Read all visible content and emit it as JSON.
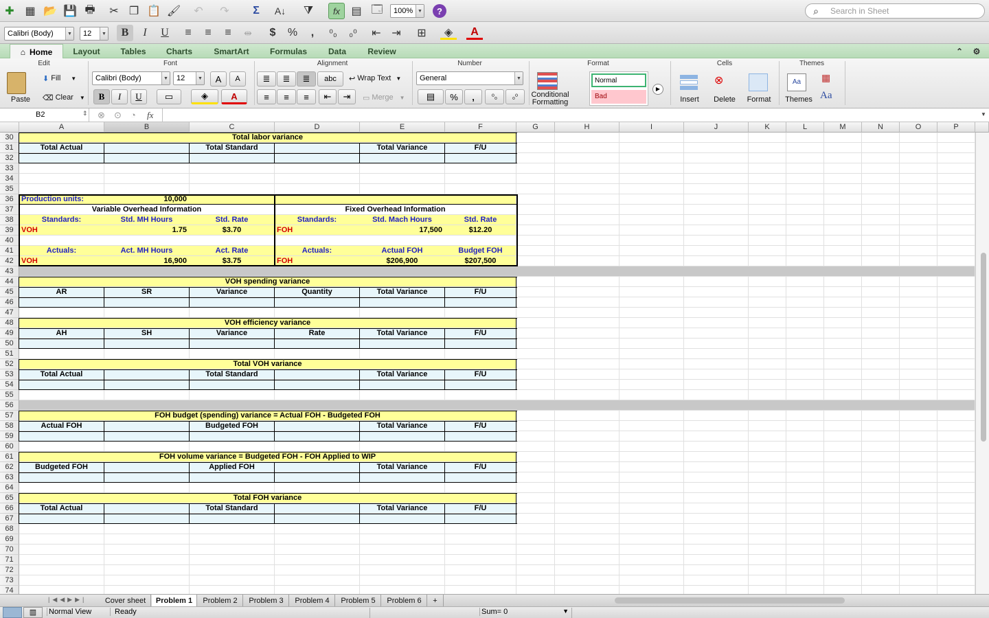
{
  "toolbar": {
    "font": "Calibri (Body)",
    "size": "12",
    "zoom": "100%",
    "search_placeholder": "Search in Sheet"
  },
  "tabs": [
    "Home",
    "Layout",
    "Tables",
    "Charts",
    "SmartArt",
    "Formulas",
    "Data",
    "Review"
  ],
  "groups": {
    "edit": "Edit",
    "font": "Font",
    "alignment": "Alignment",
    "number": "Number",
    "format": "Format",
    "cells": "Cells",
    "themes": "Themes"
  },
  "ribbon": {
    "paste": "Paste",
    "fill": "Fill",
    "clear": "Clear",
    "font": "Calibri (Body)",
    "size": "12",
    "wrap": "Wrap Text",
    "merge": "Merge",
    "number_format": "General",
    "cond1": "Conditional",
    "cond2": "Formatting",
    "style_normal": "Normal",
    "style_bad": "Bad",
    "insert": "Insert",
    "delete": "Delete",
    "format": "Format",
    "themes": "Themes",
    "bold": "B",
    "italic": "I",
    "underline": "U",
    "abc": "abc",
    "aa": "Aa"
  },
  "formula_bar": {
    "name_box": "B2",
    "fx": "fx",
    "formula": ""
  },
  "columns": [
    "A",
    "B",
    "C",
    "D",
    "E",
    "F",
    "G",
    "H",
    "I",
    "J",
    "K",
    "L",
    "M",
    "N",
    "O",
    "P"
  ],
  "rows": [
    "30",
    "31",
    "32",
    "33",
    "34",
    "35",
    "36",
    "37",
    "38",
    "39",
    "40",
    "41",
    "42",
    "43",
    "44",
    "45",
    "46",
    "47",
    "48",
    "49",
    "50",
    "51",
    "52",
    "53",
    "54",
    "55",
    "56",
    "57",
    "58",
    "59",
    "60",
    "61",
    "62",
    "63",
    "64",
    "65",
    "66",
    "67",
    "68",
    "69",
    "70",
    "71",
    "72",
    "73",
    "74"
  ],
  "cells": {
    "r30": "Total labor variance",
    "r31": [
      "Total Actual",
      "",
      "Total Standard",
      "",
      "Total Variance",
      "F/U"
    ],
    "r36a": "Production units:",
    "r36b": "10,000",
    "r37a": "Variable Overhead Information",
    "r37b": "Fixed Overhead Information",
    "r38": [
      "Standards:",
      "Std. MH Hours",
      "Std. Rate",
      "Standards:",
      "Std. Mach Hours",
      "Std. Rate"
    ],
    "r39": [
      "VOH",
      "1.75",
      "$3.70",
      "FOH",
      "17,500",
      "$12.20"
    ],
    "r41": [
      "Actuals:",
      "Act. MH Hours",
      "Act. Rate",
      "Actuals:",
      "Actual FOH",
      "Budget FOH"
    ],
    "r42": [
      "VOH",
      "16,900",
      "$3.75",
      "FOH",
      "$206,900",
      "$207,500"
    ],
    "r44": "VOH spending variance",
    "r45": [
      "AR",
      "SR",
      "Variance",
      "Quantity",
      "Total Variance",
      "F/U"
    ],
    "r48": "VOH efficiency variance",
    "r49": [
      "AH",
      "SH",
      "Variance",
      "Rate",
      "Total Variance",
      "F/U"
    ],
    "r52": "Total VOH variance",
    "r53": [
      "Total Actual",
      "",
      "Total Standard",
      "",
      "Total Variance",
      "F/U"
    ],
    "r57": "FOH budget (spending) variance = Actual FOH - Budgeted FOH",
    "r58": [
      "Actual FOH",
      "",
      "Budgeted FOH",
      "",
      "Total Variance",
      "F/U"
    ],
    "r61": "FOH volume variance = Budgeted FOH - FOH Applied to WIP",
    "r62": [
      "Budgeted FOH",
      "",
      "Applied FOH",
      "",
      "Total Variance",
      "F/U"
    ],
    "r65": "Total FOH variance",
    "r66": [
      "Total Actual",
      "",
      "Total Standard",
      "",
      "Total Variance",
      "F/U"
    ]
  },
  "sheets": [
    "Cover sheet",
    "Problem 1",
    "Problem 2",
    "Problem 3",
    "Problem 4",
    "Problem 5",
    "Problem 6",
    "+"
  ],
  "status": {
    "view": "Normal View",
    "ready": "Ready",
    "sum": "Sum= 0"
  },
  "colors": {
    "yellow": "#ffff99",
    "lightblue": "#e8f6fb",
    "gray": "#c8c8c8",
    "ribbon_green": "#b7dbb7"
  }
}
